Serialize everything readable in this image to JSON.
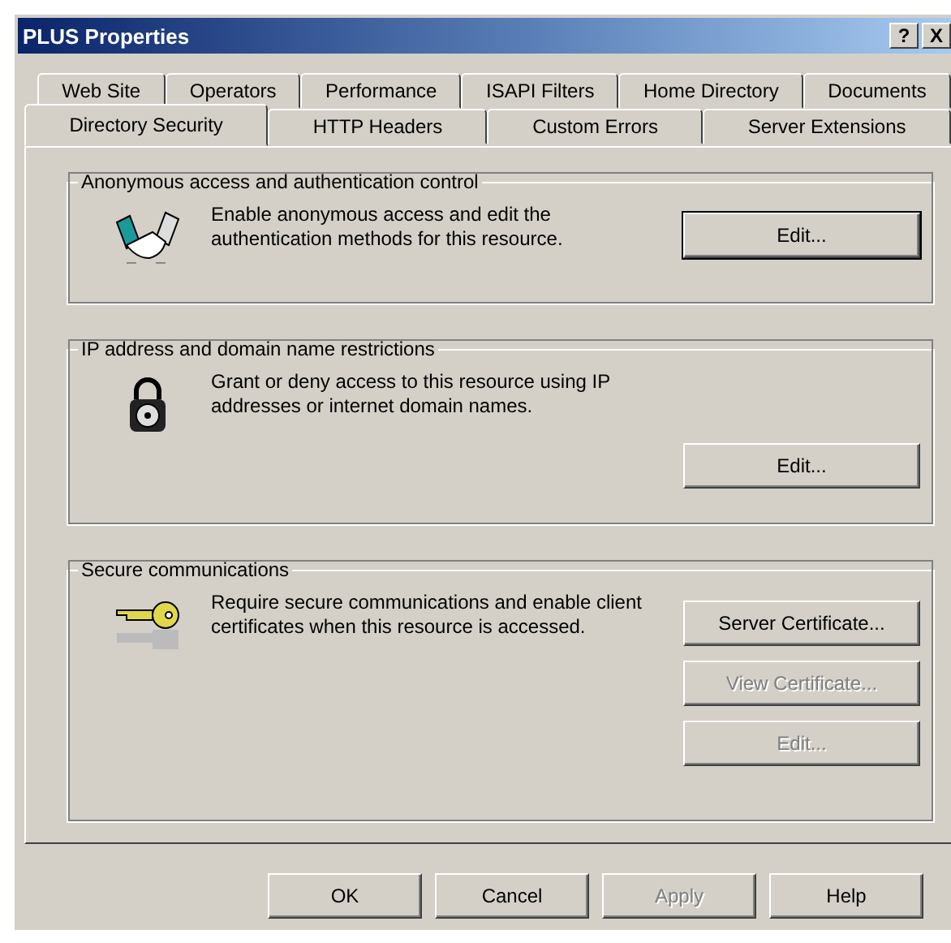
{
  "window": {
    "title": "PLUS Properties",
    "title_buttons": [
      "?",
      "X"
    ]
  },
  "tab_rows": [
    {
      "tabs": [
        {
          "label": "Web Site",
          "selected": false
        },
        {
          "label": "Operators",
          "selected": false
        },
        {
          "label": "Performance",
          "selected": false
        },
        {
          "label": "ISAPI Filters",
          "selected": false
        },
        {
          "label": "Home Directory",
          "selected": false
        },
        {
          "label": "Documents",
          "selected": false
        }
      ]
    },
    {
      "tabs": [
        {
          "label": "Directory Security",
          "selected": true
        },
        {
          "label": "HTTP Headers",
          "selected": false
        },
        {
          "label": "Custom Errors",
          "selected": false
        },
        {
          "label": "Server Extensions",
          "selected": false
        }
      ]
    }
  ],
  "groups": [
    {
      "title": "Anonymous access and authentication control",
      "kind": "handshake",
      "text": "Enable anonymous access and edit the authentication methods for this resource.",
      "buttons": [
        {
          "label": "Edit...",
          "disabled": false,
          "default": true
        }
      ]
    },
    {
      "title": "IP address and domain name restrictions",
      "kind": "lock",
      "text": "Grant or deny access to this resource using IP addresses or internet domain names.",
      "buttons": [
        {
          "label": "Edit...",
          "disabled": false,
          "default": false
        }
      ]
    },
    {
      "title": "Secure communications",
      "kind": "key",
      "text": "Require secure communications and enable client certificates when this resource is accessed.",
      "buttons": [
        {
          "label": "Server Certificate...",
          "disabled": false,
          "default": false
        },
        {
          "label": "View Certificate...",
          "disabled": true,
          "default": false
        },
        {
          "label": "Edit...",
          "disabled": true,
          "default": false
        }
      ]
    }
  ],
  "dialog_buttons": [
    {
      "label": "OK",
      "disabled": false
    },
    {
      "label": "Cancel",
      "disabled": false
    },
    {
      "label": "Apply",
      "disabled": true
    },
    {
      "label": "Help",
      "disabled": false
    }
  ]
}
